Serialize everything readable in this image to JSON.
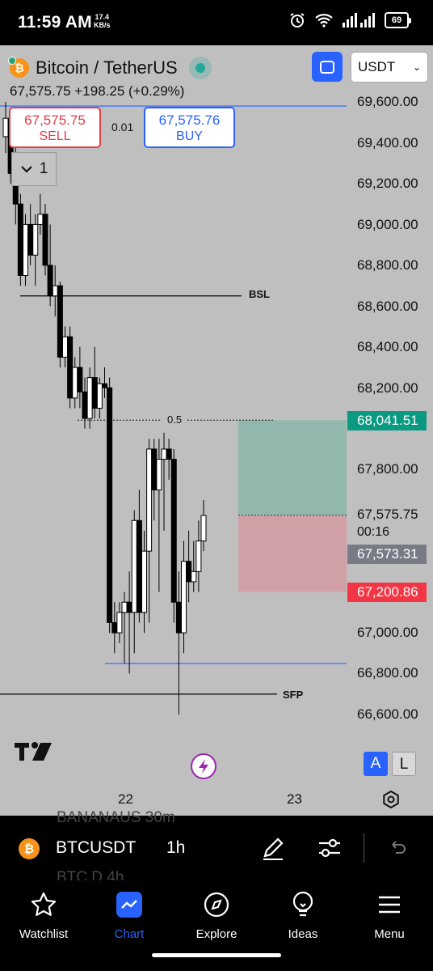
{
  "status_bar": {
    "time": "11:59 AM",
    "speed_value": "17.4",
    "speed_unit": "KB/s",
    "battery": "69"
  },
  "header": {
    "title": "Bitcoin / TetherUS",
    "price_line": "67,575.75  +198.25 (+0.29%)",
    "currency": "USDT"
  },
  "trade": {
    "sell_price": "67,575.75",
    "sell_label": "SELL",
    "spread": "0.01",
    "buy_price": "67,575.76",
    "buy_label": "BUY",
    "collapse_count": "1"
  },
  "price_axis": {
    "labels": [
      "69,600.00",
      "69,400.00",
      "69,200.00",
      "69,000.00",
      "68,800.00",
      "68,600.00",
      "68,400.00",
      "68,200.00",
      "67,800.00",
      "67,000.00",
      "66,800.00",
      "66,600.00"
    ],
    "take_profit": "68,041.51",
    "current": "67,575.75",
    "countdown": "00:16",
    "bid": "67,573.31",
    "stop_loss": "67,200.86"
  },
  "annotations": {
    "bsl": "BSL",
    "sfp": "SFP",
    "fib": "0.5"
  },
  "time_axis": {
    "labels": [
      "22",
      "23"
    ]
  },
  "scale_modes": {
    "auto": "A",
    "log": "L"
  },
  "symbol_bar": {
    "symbol": "BTCUSDT",
    "timeframe": "1h",
    "ghost_above": "BANANAUS  30m",
    "ghost_below": "BTC.D  4h"
  },
  "nav": {
    "items": [
      {
        "label": "Watchlist",
        "icon": "star-icon"
      },
      {
        "label": "Chart",
        "icon": "chart-icon"
      },
      {
        "label": "Explore",
        "icon": "compass-icon"
      },
      {
        "label": "Ideas",
        "icon": "lightbulb-icon"
      },
      {
        "label": "Menu",
        "icon": "menu-icon"
      }
    ]
  },
  "colors": {
    "bg": "#bfbfbf",
    "accent": "#2962ff",
    "sell": "#e53b46",
    "tp": "#0a9981",
    "sl": "#f23645"
  },
  "chart_data": {
    "type": "candlestick",
    "symbol": "BTCUSDT",
    "interval": "1h",
    "ylim": [
      66500,
      69650
    ],
    "candles": [
      [
        69430,
        69600,
        69350,
        69520
      ],
      [
        69520,
        69550,
        69200,
        69250
      ],
      [
        69250,
        69400,
        69000,
        69100
      ],
      [
        69100,
        69150,
        68700,
        68750
      ],
      [
        68750,
        69050,
        68700,
        69000
      ],
      [
        69000,
        69100,
        68800,
        68850
      ],
      [
        68850,
        69050,
        68700,
        69000
      ],
      [
        69000,
        69150,
        68950,
        69050
      ],
      [
        69050,
        69100,
        68750,
        68800
      ],
      [
        68800,
        69000,
        68600,
        68650
      ],
      [
        68650,
        68800,
        68550,
        68700
      ],
      [
        68700,
        68720,
        68300,
        68350
      ],
      [
        68350,
        68500,
        68300,
        68450
      ],
      [
        68450,
        68500,
        68100,
        68150
      ],
      [
        68150,
        68350,
        68100,
        68300
      ],
      [
        68300,
        68400,
        68100,
        68180
      ],
      [
        68180,
        68250,
        68000,
        68050
      ],
      [
        68050,
        68300,
        68000,
        68250
      ],
      [
        68250,
        68400,
        68050,
        68100
      ],
      [
        68100,
        68250,
        68050,
        68220
      ],
      [
        68220,
        68300,
        68150,
        68200
      ],
      [
        68200,
        68250,
        67000,
        67050
      ],
      [
        67050,
        67150,
        66900,
        67000
      ],
      [
        67000,
        67150,
        66950,
        67100
      ],
      [
        67100,
        67200,
        66850,
        67150
      ],
      [
        67150,
        67300,
        66800,
        67100
      ],
      [
        67100,
        67600,
        66900,
        67550
      ],
      [
        67550,
        67700,
        67050,
        67100
      ],
      [
        67100,
        67500,
        67000,
        67400
      ],
      [
        67400,
        67950,
        67050,
        67900
      ],
      [
        67900,
        67950,
        67550,
        67700
      ],
      [
        67700,
        67950,
        67200,
        67850
      ],
      [
        67850,
        67980,
        67500,
        67900
      ],
      [
        67900,
        67950,
        67750,
        67850
      ],
      [
        67850,
        67900,
        67050,
        67150
      ],
      [
        67150,
        67300,
        66600,
        67000
      ],
      [
        67000,
        67450,
        66900,
        67350
      ],
      [
        67350,
        67500,
        67150,
        67250
      ],
      [
        67250,
        67450,
        67200,
        67300
      ],
      [
        67300,
        67550,
        67200,
        67450
      ],
      [
        67450,
        67650,
        67400,
        67575
      ]
    ],
    "levels": {
      "bsl": 68650,
      "fib_0_5": 68041.51,
      "sfp_low": 66850,
      "sfp": 66700,
      "buy_line": 69580,
      "take_profit": 68041.51,
      "entry": 67575.75,
      "stop_loss": 67200.86
    }
  }
}
